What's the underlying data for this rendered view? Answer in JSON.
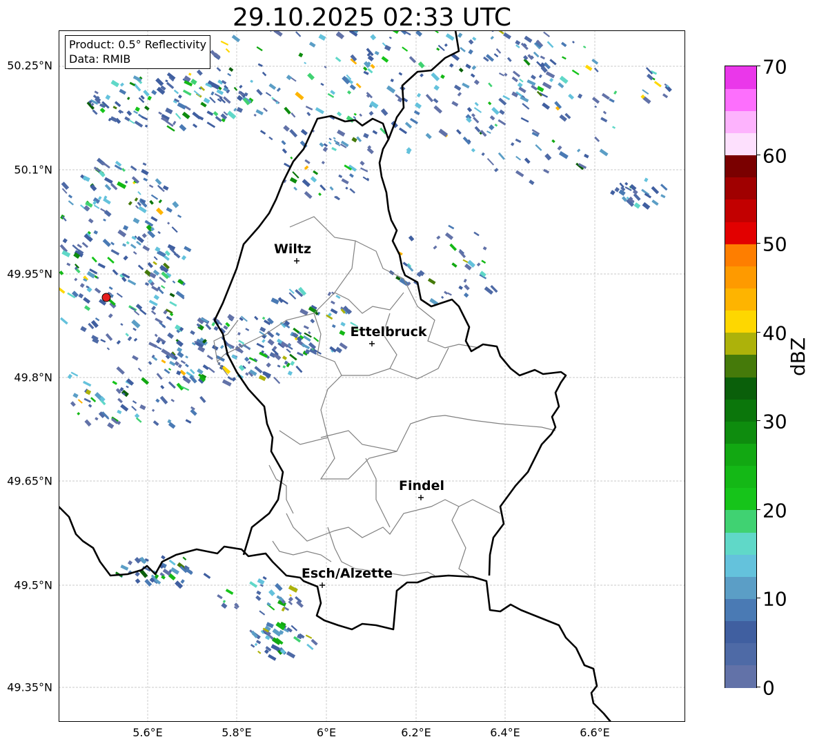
{
  "title": "29.10.2025 02:33 UTC",
  "info": {
    "product": "Product: 0.5° Reflectivity",
    "data": "Data: RMIB"
  },
  "axes": {
    "y_ticks": [
      "50.25°N",
      "50.1°N",
      "49.95°N",
      "49.8°N",
      "49.65°N",
      "49.5°N",
      "49.35°N"
    ],
    "x_ticks": [
      "5.6°E",
      "5.8°E",
      "6°E",
      "6.2°E",
      "6.4°E",
      "6.6°E"
    ]
  },
  "cities": [
    {
      "name": "Wiltz"
    },
    {
      "name": "Ettelbruck"
    },
    {
      "name": "Findel"
    },
    {
      "name": "Esch/Alzette"
    }
  ],
  "colorbar": {
    "label": "dBZ",
    "ticks": [
      "70",
      "60",
      "50",
      "40",
      "30",
      "20",
      "10",
      "0"
    ],
    "colors": [
      "#6272a8",
      "#4e6aa6",
      "#405fa0",
      "#4a7ab4",
      "#5b9ec6",
      "#64c2dc",
      "#60d8c8",
      "#40d272",
      "#16c41a",
      "#14b816",
      "#12a812",
      "#0e8c0e",
      "#0b760b",
      "#0a5f0a",
      "#457a0a",
      "#adb20a",
      "#fed700",
      "#feb400",
      "#fe9a00",
      "#fe7e00",
      "#e20000",
      "#c20000",
      "#a00000",
      "#7a0000",
      "#fde0fd",
      "#fdb3fd",
      "#fd6ffd",
      "#ea37ea"
    ]
  }
}
